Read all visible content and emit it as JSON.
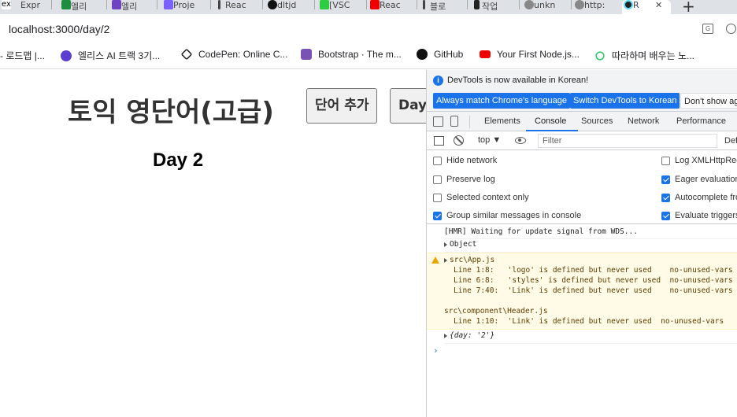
{
  "browser": {
    "tabs": [
      {
        "label": "Expr",
        "fav": "ex",
        "color": "#fff"
      },
      {
        "label": "엘리",
        "fav": "",
        "color": "#1e8e3e"
      },
      {
        "label": "엘리",
        "fav": "",
        "color": "#6f42c1"
      },
      {
        "label": "Proje",
        "fav": "",
        "color": "#7b61ff"
      },
      {
        "label": "Reac",
        "fav": "",
        "color": "#444"
      },
      {
        "label": "dltjd",
        "fav": "",
        "color": "#111"
      },
      {
        "label": "[VSC",
        "fav": "",
        "color": "#2ecc40"
      },
      {
        "label": "Reac",
        "fav": "",
        "color": "#e00"
      },
      {
        "label": "블로",
        "fav": "",
        "color": "#444"
      },
      {
        "label": "작업",
        "fav": "",
        "color": "#222"
      },
      {
        "label": "unkn",
        "fav": "",
        "color": "#888"
      },
      {
        "label": "http:",
        "fav": "",
        "color": "#888"
      },
      {
        "label": "R",
        "fav": "",
        "color": "#61dafb"
      }
    ],
    "close_glyph": "✕",
    "new_tab_glyph": "+",
    "url": "localhost:3000/day/2"
  },
  "bookmarks": [
    {
      "label": "- 로드맵 |...",
      "color": ""
    },
    {
      "label": "엘리스 AI 트랙 3기...",
      "color": "#5b3fd0"
    },
    {
      "label": "CodePen: Online C...",
      "color": "#222"
    },
    {
      "label": "Bootstrap · The m...",
      "color": "#7952b3"
    },
    {
      "label": "GitHub",
      "color": "#111"
    },
    {
      "label": "Your First Node.js...",
      "color": "#e00"
    },
    {
      "label": "따라하며 배우는 노...",
      "color": "#2ecc71"
    }
  ],
  "page": {
    "title": "토익 영단어(고급)",
    "add_word_label": "단어 추가",
    "add_day_label": "Day",
    "day_heading": "Day 2"
  },
  "devtools": {
    "info_text": "DevTools is now available in Korean!",
    "btn_match": "Always match Chrome's language",
    "btn_switch": "Switch DevTools to Korean",
    "btn_dont": "Don't show ag",
    "tabs": [
      "Elements",
      "Console",
      "Sources",
      "Network",
      "Performance"
    ],
    "active_tab": "Console",
    "context": "top ▼",
    "filter_placeholder": "Filter",
    "levels": "Def",
    "settings_left": [
      {
        "label": "Hide network",
        "checked": false
      },
      {
        "label": "Preserve log",
        "checked": false
      },
      {
        "label": "Selected context only",
        "checked": false
      },
      {
        "label": "Group similar messages in console",
        "checked": true
      }
    ],
    "settings_right": [
      {
        "label": "Log XMLHttpReq",
        "checked": false
      },
      {
        "label": "Eager evaluation",
        "checked": true
      },
      {
        "label": "Autocomplete fro",
        "checked": true
      },
      {
        "label": "Evaluate triggers",
        "checked": true
      }
    ],
    "console": {
      "hmr": "[HMR] Waiting for update signal from WDS...",
      "object": "Object",
      "warn_file1": "src\\App.js",
      "warn_lines1": [
        "Line 1:8:   'logo' is defined but never used    no-unused-vars",
        "Line 6:8:   'styles' is defined but never used  no-unused-vars",
        "Line 7:40:  'Link' is defined but never used    no-unused-vars"
      ],
      "warn_file2": "src\\component\\Header.js",
      "warn_lines2": [
        "Line 1:10:  'Link' is defined but never used  no-unused-vars"
      ],
      "day_obj": "{day: '2'}",
      "prompt": "›"
    }
  }
}
